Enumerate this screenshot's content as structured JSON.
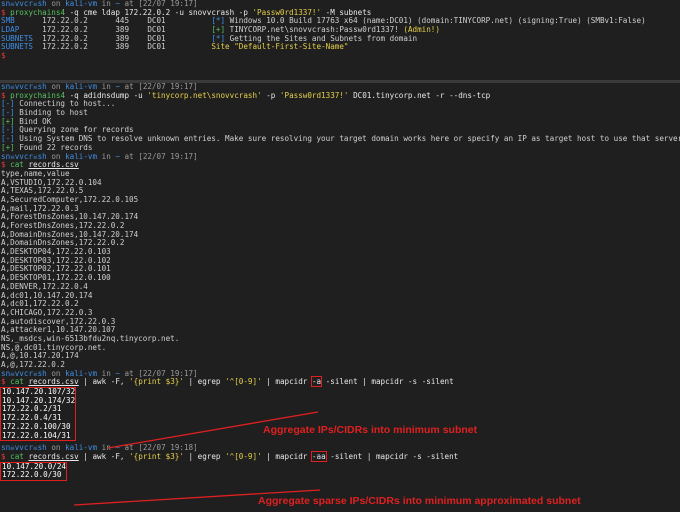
{
  "prompt": {
    "user": "sn",
    "user2": "vvcr",
    "user3": "sh",
    "on": " on ",
    "host": "kali-vm",
    "in": " in ",
    "path": "~",
    "at": " at ",
    "sigil": "$"
  },
  "pane1": {
    "time": "[22/07 19:17]",
    "command": {
      "prog": "proxychains4",
      "rest1": " -q cme ldap 172.22.0.2 -u snovvcrash -p ",
      "pw": "'Passw0rd1337!'",
      "rest2": " -M subnets"
    },
    "rows": [
      {
        "proto": "SMB",
        "ip": "172.22.0.2",
        "port": "445",
        "name": "DC01",
        "tag": "[*]",
        "msg": " Windows 10.0 Build 17763 x64 (name:DC01) (domain:TINYCORP.net) (signing:True) (SMBv1:False)",
        "admin": ""
      },
      {
        "proto": "LDAP",
        "ip": "172.22.0.2",
        "port": "389",
        "name": "DC01",
        "tag": "[+]",
        "msg": " TINYCORP.net\\snovvcrash:Passw0rd1337! ",
        "admin": "(Admin!)"
      },
      {
        "proto": "SUBNETS",
        "ip": "172.22.0.2",
        "port": "389",
        "name": "DC01",
        "tag": "[*]",
        "msg": " Getting the Sites and Subnets from domain",
        "admin": ""
      },
      {
        "proto": "SUBNETS",
        "ip": "172.22.0.2",
        "port": "389",
        "name": "DC01",
        "tag": "",
        "msg": "Site \"Default-First-Site-Name\"",
        "admin": ""
      }
    ]
  },
  "pane2": {
    "time1": "[22/07 19:17]",
    "cmd1": {
      "prog": "proxychains4",
      "rest1": " -q adidnsdump -u ",
      "user": "'tinycorp.net\\snovvcrash'",
      "rest2": " -p ",
      "pw": "'Passw0rd1337!'",
      "rest3": " DC01.tinycorp.net -r --dns-tcp"
    },
    "log": [
      {
        "tag": "[-]",
        "text": " Connecting to host..."
      },
      {
        "tag": "[-]",
        "text": " Binding to host"
      },
      {
        "tag": "[+]",
        "text": " Bind OK"
      },
      {
        "tag": "[-]",
        "text": " Querying zone for records"
      },
      {
        "tag": "[-]",
        "text": " Using System DNS to resolve unknown entries. Make sure resolving your target domain works here or specify an IP as target host to use that server for queries"
      },
      {
        "tag": "[+]",
        "text": " Found 22 records"
      }
    ],
    "time2": "[22/07 19:17]",
    "cat_cmd": {
      "prog": "cat",
      "file": "records.csv"
    },
    "csv": [
      "type,name,value",
      "A,VSTUDIO,172.22.0.104",
      "A,TEXAS,172.22.0.5",
      "A,SecuredComputer,172.22.0.105",
      "A,mail,172.22.0.3",
      "A,ForestDnsZones,10.147.20.174",
      "A,ForestDnsZones,172.22.0.2",
      "A,DomainDnsZones,10.147.20.174",
      "A,DomainDnsZones,172.22.0.2",
      "A,DESKTOP04,172.22.0.103",
      "A,DESKTOP03,172.22.0.102",
      "A,DESKTOP02,172.22.0.101",
      "A,DESKTOP01,172.22.0.100",
      "A,DENVER,172.22.0.4",
      "A,dc01,10.147.20.174",
      "A,dc01,172.22.0.2",
      "A,CHICAGO,172.22.0.3",
      "A,autodiscover,172.22.0.3",
      "A,attacker1,10.147.20.107",
      "NS,_msdcs,win-6513bfdu2nq.tinycorp.net.",
      "NS,@,dc01.tinycorp.net.",
      "A,@,10.147.20.174",
      "A,@,172.22.0.2"
    ],
    "time3": "[22/07 19:17]",
    "pipe1": {
      "prog": "cat",
      "file": "records.csv",
      "p1": " | awk -F, ",
      "awkarg": "'{print $3}'",
      "p2": " | egrep ",
      "rx": "'^[0-9]'",
      "p3": " | mapcidr ",
      "flag": "-a",
      "p4": " -silent | mapcidr -s -silent"
    },
    "out1": [
      "10.147.20.107/32",
      "10.147.20.174/32",
      "172.22.0.2/31",
      "172.22.0.4/31",
      "172.22.0.100/30",
      "172.22.0.104/31"
    ],
    "time4": "[22/07 19:18]",
    "pipe2": {
      "prog": "cat",
      "file": "records.csv",
      "p1": " | awk -F, ",
      "awkarg": "'{print $3}'",
      "p2": " | egrep ",
      "rx": "'^[0-9]'",
      "p3": " | mapcidr ",
      "flag": "-aa",
      "p4": " -silent | mapcidr -s -silent"
    },
    "out2": [
      "10.147.20.0/24",
      "172.22.0.0/30"
    ]
  },
  "annotations": {
    "a1": "Aggregate IPs/CIDRs into minimum subnet",
    "a2": "Aggregate sparse IPs/CIDRs into minimum approximated subnet"
  },
  "colors": {
    "accent_red": "#e02020",
    "prompt_blue": "#3f8fe6",
    "ok_green": "#56c25f",
    "string_yellow": "#e6d04a"
  }
}
